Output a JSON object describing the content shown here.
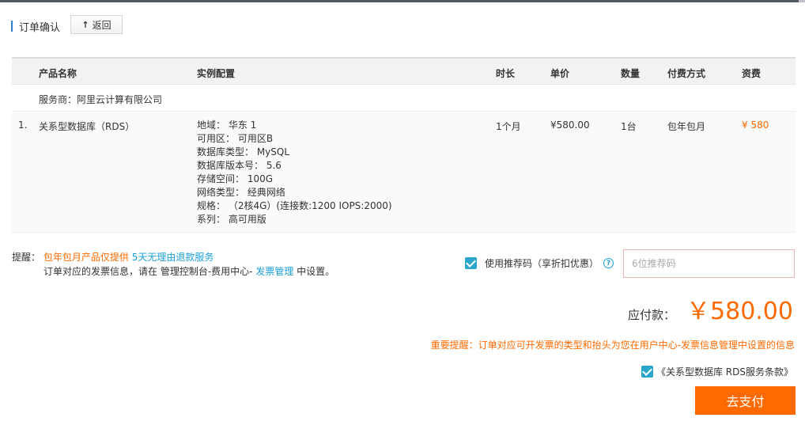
{
  "header": {
    "title": "订单确认",
    "back_label": "返回",
    "back_icon": "arrow-up-icon"
  },
  "table": {
    "columns": [
      "产品名称",
      "实例配置",
      "时长",
      "单价",
      "数量",
      "付费方式",
      "资费"
    ],
    "vendor": "服务商：阿里云计算有限公司",
    "rows": [
      {
        "index": "1.",
        "product": "关系型数据库（RDS）",
        "config": [
          "地域： 华东 1",
          "可用区： 可用区B",
          "数据库类型： MySQL",
          "数据库版本号： 5.6",
          "存储空间： 100G",
          "网络类型： 经典网络",
          "规格： （2核4G）(连接数:1200 IOPS:2000)",
          "系列： 高可用版"
        ],
        "duration": "1个月",
        "unit_price": "¥580.00",
        "quantity": "1台",
        "payment": "包年包月",
        "fee": "¥ 580"
      }
    ]
  },
  "reminder": {
    "label": "提醒：",
    "notice_orange": "包年包月产品仅提供",
    "notice_blue": "5天无理由退款服务",
    "line2_prefix": "订单对应的发票信息，请在 管理控制台-费用中心-",
    "line2_link": "发票管理",
    "line2_suffix": "中设置。"
  },
  "promo": {
    "label": "使用推荐码（享折扣优惠）",
    "placeholder": "6位推荐码",
    "checked": true,
    "help_icon": "question-circle-icon"
  },
  "payment": {
    "amount_label": "应付款：",
    "amount_value": "￥580.00",
    "important_note": "重要提醒：订单对应可开发票的类型和抬头为您在用户中心-发票信息管理中设置的信息",
    "terms_label": "《关系型数据库 RDS服务条款》",
    "terms_checked": true,
    "pay_label": "去支付"
  },
  "colors": {
    "accent_orange": "#ff6a00",
    "link_blue": "#1a9fd9",
    "checkbox_blue": "#2ba6cb"
  }
}
